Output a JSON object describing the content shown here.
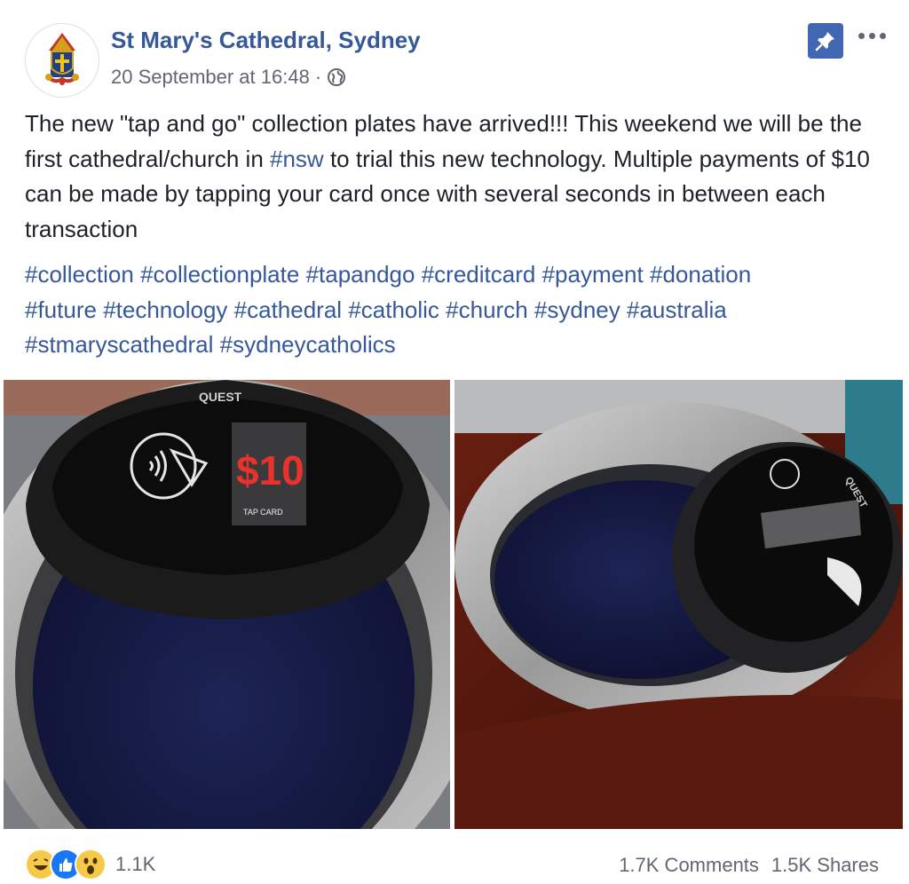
{
  "post": {
    "page_name": "St Mary's Cathedral, Sydney",
    "date": "20 September at 16:48",
    "separator": "·",
    "text_before_tag": "The new \"tap and go\" collection plates have arrived!!! This weekend we will be the first cathedral/church in ",
    "inline_tag": "#nsw",
    "text_after_tag": " to trial this new technology. Multiple payments of $10 can be made by tapping your card once with several seconds in between each transaction",
    "hashtags": [
      "#collection",
      "#collectionplate",
      "#tapandgo",
      "#creditcard",
      "#payment",
      "#donation",
      "#future",
      "#technology",
      "#cathedral",
      "#catholic",
      "#church",
      "#sydney",
      "#australia",
      "#stmaryscathedral",
      "#sydneycatholics"
    ]
  },
  "photo_left": {
    "brand": "QUEST",
    "amount": "$10",
    "screen_label": "TAP CARD"
  },
  "photo_right": {
    "brand": "QUEST"
  },
  "footer": {
    "reaction_count": "1.1K",
    "comments": "1.7K Comments",
    "shares": "1.5K Shares"
  },
  "icons": {
    "avatar": "cathedral-crest-icon",
    "privacy": "globe-icon",
    "pin": "pin-icon",
    "more": "more-options-icon",
    "reactions": [
      "haha-icon",
      "like-icon",
      "wow-icon"
    ]
  },
  "colors": {
    "link": "#365899",
    "meta": "#616770",
    "pin_bg": "#4267b2",
    "like_blue": "#1877f2",
    "emoji_yellow": "#f7c94a",
    "amount_red": "#e8322b"
  }
}
